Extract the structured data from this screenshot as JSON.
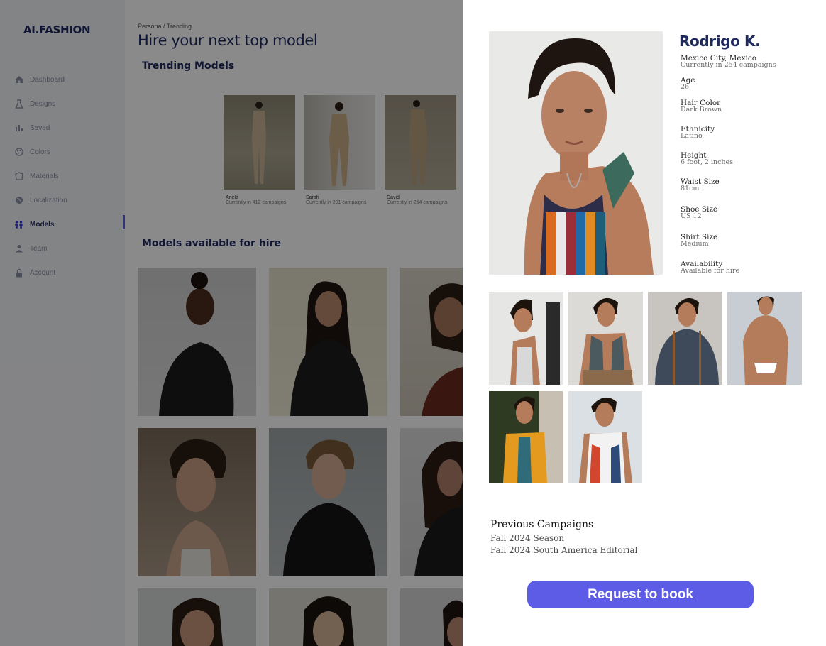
{
  "app": {
    "logo": "AI.FASHION"
  },
  "sidebar": {
    "items": [
      {
        "label": "Dashboard",
        "icon": "home-icon"
      },
      {
        "label": "Designs",
        "icon": "dress-icon"
      },
      {
        "label": "Saved",
        "icon": "bar-chart-icon"
      },
      {
        "label": "Colors",
        "icon": "palette-icon"
      },
      {
        "label": "Materials",
        "icon": "fabric-icon"
      },
      {
        "label": "Localization",
        "icon": "globe-icon"
      },
      {
        "label": "Models",
        "icon": "people-icon",
        "active": true
      },
      {
        "label": "Team",
        "icon": "person-icon"
      },
      {
        "label": "Account",
        "icon": "lock-icon"
      }
    ]
  },
  "main": {
    "breadcrumb": "Persona / Trending",
    "title": "Hire your next top model",
    "trending_title": "Trending Models",
    "trending": [
      {
        "name": "Ariela",
        "sub": "Currently in 412 campaigns"
      },
      {
        "name": "Sarah",
        "sub": "Currently in 291 campaigns"
      },
      {
        "name": "David",
        "sub": "Currently in 254 campaigns"
      }
    ],
    "hire_title": "Models available for hire"
  },
  "profile": {
    "name": "Rodrigo K.",
    "location": "Mexico City, Mexico",
    "campaigns": "Currently in 254 campaigns",
    "attributes": [
      {
        "key": "Age",
        "value": "26"
      },
      {
        "key": "Hair Color",
        "value": "Dark Brown"
      },
      {
        "key": "Ethnicity",
        "value": "Latino"
      },
      {
        "key": "Height",
        "value": "6 foot, 2 inches"
      },
      {
        "key": "Waist Size",
        "value": "81cm"
      },
      {
        "key": "Shoe Size",
        "value": "US 12"
      },
      {
        "key": "Shirt Size",
        "value": "Medium"
      },
      {
        "key": "Availability",
        "value": "Available for hire"
      }
    ],
    "previous_campaigns_title": "Previous Campaigns",
    "previous_campaigns": [
      "Fall 2024 Season",
      "Fall 2024 South America Editorial"
    ],
    "book_label": "Request to book"
  },
  "colors": {
    "accent": "#5d5ce6",
    "navy": "#1e2a5e",
    "overlay": "rgba(0,0,0,0.46)"
  }
}
